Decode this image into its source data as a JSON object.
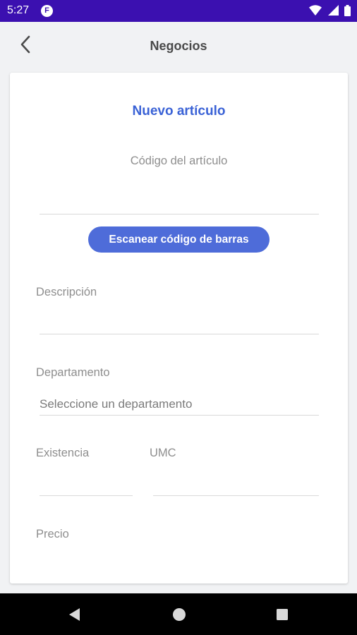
{
  "status": {
    "time": "5:27",
    "app_badge": "F",
    "bar_color": "#3b10b0"
  },
  "header": {
    "title": "Negocios",
    "back_icon": "chevron-left-icon"
  },
  "form": {
    "title": "Nuevo artículo",
    "code_label": "Código del artículo",
    "scan_button_label": "Escanear código de barras",
    "description_label": "Descripción",
    "department_label": "Departamento",
    "department_value": "Seleccione un departamento",
    "stock_label": "Existencia",
    "umc_label": "UMC",
    "price_label": "Precio"
  },
  "colors": {
    "accent": "#3a62d6",
    "button": "#4e6cd9",
    "label": "#8e8e8e"
  },
  "nav": {
    "back": "triangle-back-icon",
    "home": "circle-home-icon",
    "recents": "square-recents-icon"
  }
}
